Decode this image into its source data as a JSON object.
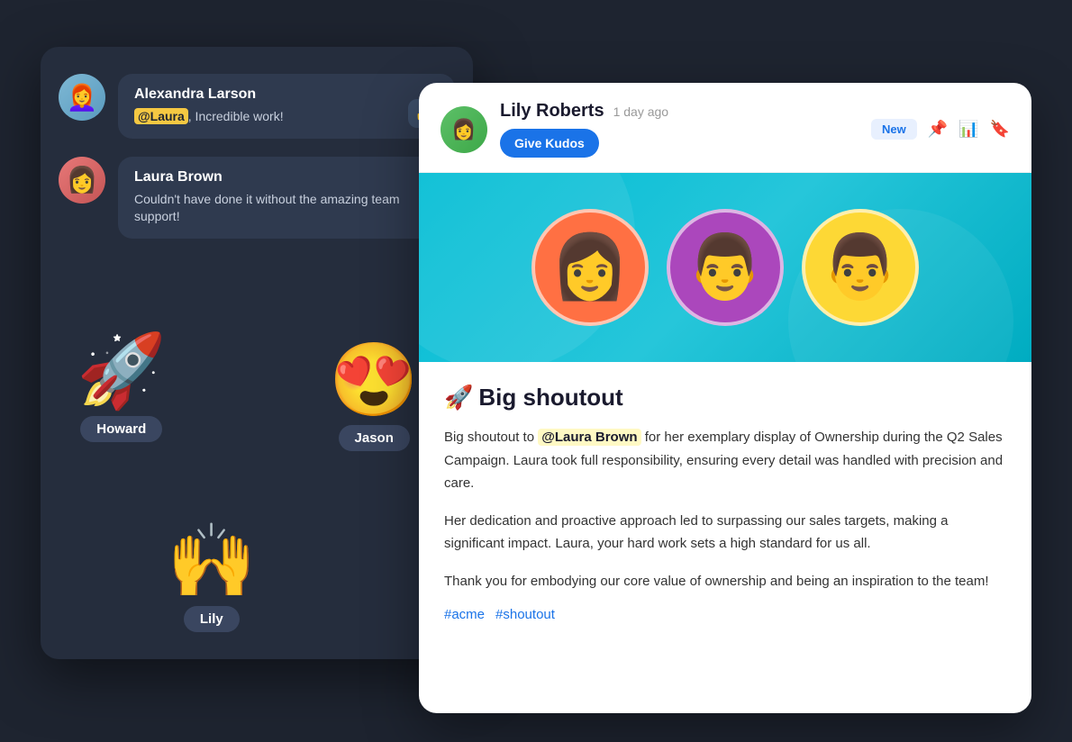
{
  "chat": {
    "messages": [
      {
        "id": "msg1",
        "sender": "Alexandra Larson",
        "avatar": "👩",
        "mention": "@Laura",
        "text": ", Incredible work!",
        "reaction": "👍"
      },
      {
        "id": "msg2",
        "sender": "Laura Brown",
        "avatar": "👩",
        "text": "Couldn't have done it without the amazing team support!"
      }
    ],
    "floating_people": [
      {
        "id": "howard",
        "emoji": "🚀",
        "label": "Howard",
        "pos": "left"
      },
      {
        "id": "jason",
        "emoji": "😍",
        "label": "Jason",
        "pos": "right"
      },
      {
        "id": "lily",
        "emoji": "🙌",
        "label": "Lily",
        "pos": "bottom"
      }
    ]
  },
  "card": {
    "poster": {
      "name": "Lily Roberts",
      "time": "1 day ago",
      "avatar_emoji": "👩"
    },
    "kudos_button": "Give Kudos",
    "new_badge": "New",
    "actions": {
      "pin": "📌",
      "chart": "📊",
      "bookmark": "🔖"
    },
    "banner_people": [
      {
        "bg": "orange",
        "emoji": "👩"
      },
      {
        "bg": "purple",
        "emoji": "👨"
      },
      {
        "bg": "yellow",
        "emoji": "👨"
      }
    ],
    "title_emoji": "🚀",
    "title": "Big shoutout",
    "paragraphs": [
      {
        "parts": [
          {
            "type": "text",
            "content": "Big shoutout to "
          },
          {
            "type": "mention",
            "content": "@Laura Brown"
          },
          {
            "type": "text",
            "content": " for her exemplary display of Ownership during the Q2 Sales Campaign. Laura took full responsibility, ensuring every detail was handled with precision and care."
          }
        ]
      },
      {
        "parts": [
          {
            "type": "text",
            "content": "Her dedication and proactive approach led to surpassing our sales targets, making a significant impact. Laura, your hard work sets a high standard for us all."
          }
        ]
      },
      {
        "parts": [
          {
            "type": "text",
            "content": "Thank you for embodying our core value of ownership and being an inspiration to the team!"
          }
        ]
      }
    ],
    "tags": [
      "#acme",
      "#shoutout"
    ]
  }
}
